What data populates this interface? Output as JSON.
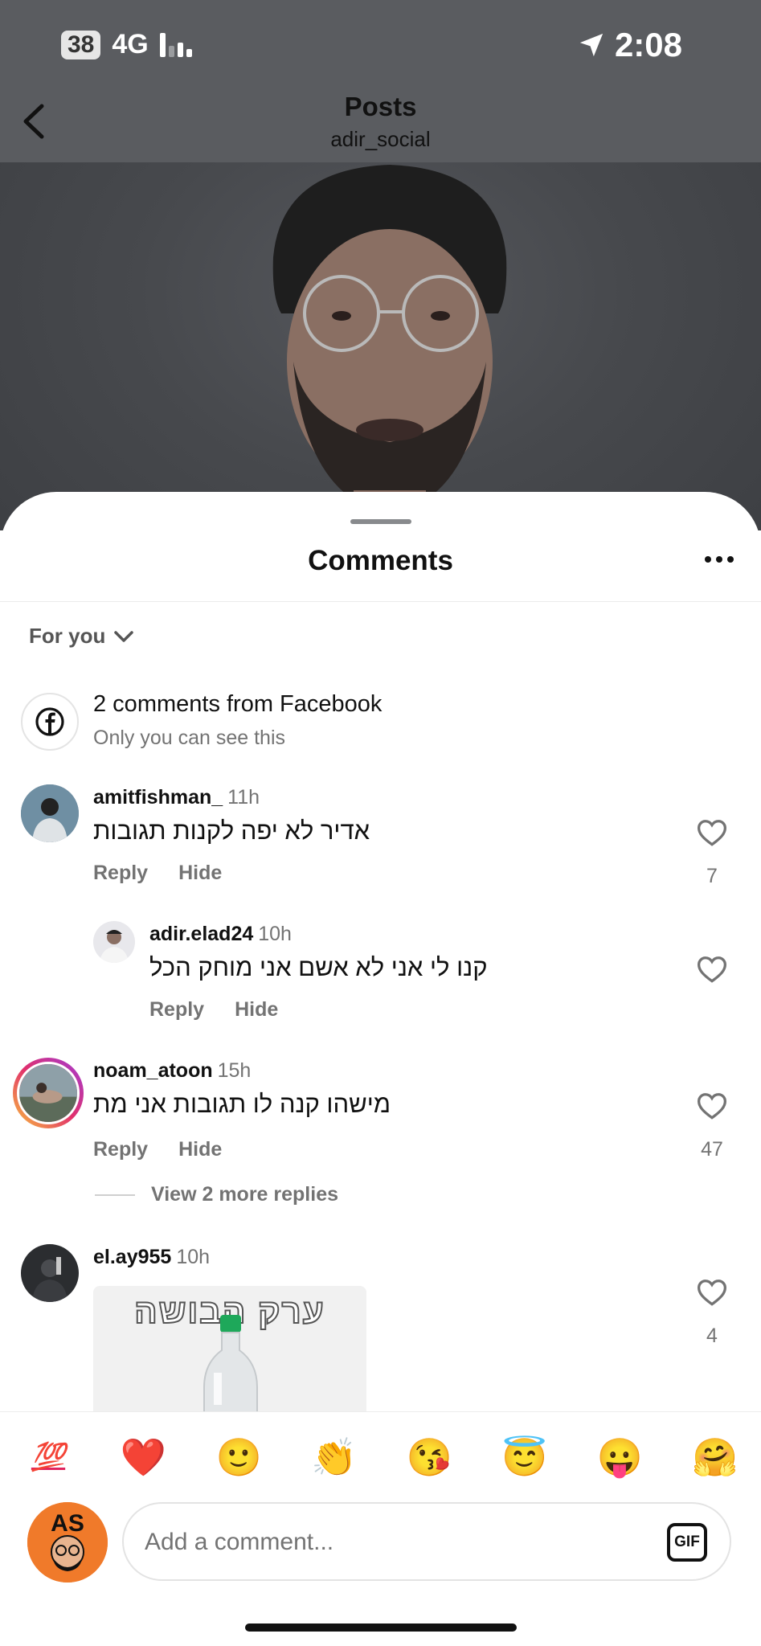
{
  "status": {
    "battery": "38",
    "network": "4G",
    "time": "2:08"
  },
  "nav": {
    "title": "Posts",
    "subtitle": "adir_social"
  },
  "sheet": {
    "title": "Comments",
    "sort": "For you"
  },
  "facebook": {
    "title": "2 comments from Facebook",
    "subtitle": "Only you can see this"
  },
  "labels": {
    "reply": "Reply",
    "hide": "Hide"
  },
  "comments": [
    {
      "user": "amitfishman_",
      "time": "11h",
      "text": "אדיר לא יפה לקנות תגובות",
      "likes": "7"
    },
    {
      "user": "adir.elad24",
      "time": "10h",
      "text": "קנו לי אני לא אשם אני מוחק הכל",
      "likes": ""
    },
    {
      "user": "noam_atoon",
      "time": "15h",
      "text": "מישהו קנה לו תגובות אני מת",
      "likes": "47",
      "view_more": "View 2 more replies"
    },
    {
      "user": "el.ay955",
      "time": "10h",
      "gif_text": "ערק הבושה",
      "likes": "4"
    }
  ],
  "emojis": [
    "💯",
    "❤️",
    "🙂",
    "👏",
    "😘",
    "😇",
    "😛",
    "🤗"
  ],
  "composer": {
    "placeholder": "Add a comment...",
    "gif_label": "GIF"
  }
}
